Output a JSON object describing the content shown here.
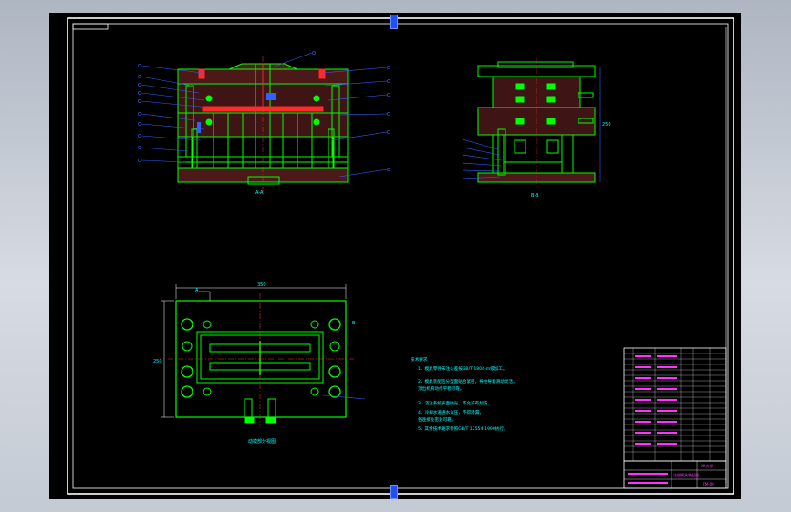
{
  "drawing": {
    "background_color": "#000000",
    "frame_color": "#ffffff",
    "mold_color": "#00ff00",
    "leader_color": "#3060ff",
    "text_color": "#00ffff",
    "centerline_color": "#ff3030",
    "cavity_color": "#ff2a2a",
    "title_block_color": "#ff33ff"
  },
  "main_view": {
    "caption": "A-A",
    "callouts": [
      "1",
      "2",
      "3",
      "4",
      "5",
      "6",
      "7",
      "8",
      "9",
      "10",
      "11",
      "12",
      "13",
      "14",
      "15",
      "16",
      "17",
      "18"
    ]
  },
  "side_view": {
    "caption": "B-B",
    "callouts": [
      "19",
      "20",
      "21",
      "22",
      "23",
      "24"
    ],
    "dim_right": "250"
  },
  "plan_view": {
    "caption": "动模部分视图",
    "dim_top": "350",
    "dim_left": "250",
    "marker_a": "A",
    "marker_b": "B"
  },
  "tech_notes": {
    "heading": "技术要求",
    "lines": [
      "1、模具零件未注公差按GB/T 1804-m级加工。",
      "2、模具装配后分型面贴合紧密，导柱导套滑动灵活，",
      "   顶出机构动作平稳可靠。",
      "3、浇注系统表面抛光，不允许有划伤。",
      "4、冷却水道通水试压，不得渗漏，",
      "   各连接处密封可靠。",
      "5、其余技术要求参照GB/T 12554-1990执行。"
    ]
  },
  "title_block": {
    "school": "XX大学",
    "drawing_name": "注塑模具装配图",
    "drawing_no": "ZM-00"
  }
}
